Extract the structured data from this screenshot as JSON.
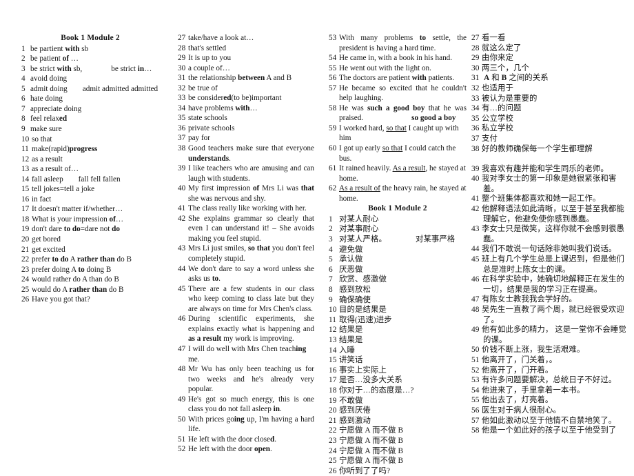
{
  "document": {
    "heading": "Book 1 Module 2",
    "columns": {
      "english_left": {
        "heading": "Book 1 Module 2",
        "items": [
          {
            "n": "1",
            "text": "be partient with sb"
          },
          {
            "n": "2",
            "text": "be patient of …"
          },
          {
            "n": "3",
            "text": "be strict with sb,        be strict in…"
          },
          {
            "n": "4",
            "text": "avoid doing"
          },
          {
            "n": "5",
            "text": "admit doing     admit admitted admitted"
          },
          {
            "n": "6",
            "text": "hate doing"
          },
          {
            "n": "7",
            "text": "appreciate doing"
          },
          {
            "n": "8",
            "text": "feel relaxed"
          },
          {
            "n": "9",
            "text": "make sure"
          },
          {
            "n": "10",
            "text": "so that"
          },
          {
            "n": "11",
            "text": "make(rapid)progress"
          },
          {
            "n": "12",
            "text": "as a result"
          },
          {
            "n": "13",
            "text": "as a result of…"
          },
          {
            "n": "14",
            "text": "fall asleep     fall fell fallen"
          },
          {
            "n": "15",
            "text": "tell jokes=tell a joke"
          },
          {
            "n": "16",
            "text": "in fact"
          },
          {
            "n": "17",
            "text": "It doesn't matter if/whether…"
          },
          {
            "n": "18",
            "text": "What is your impression of…"
          },
          {
            "n": "19",
            "text": "don't dare to do=dare not do"
          },
          {
            "n": "20",
            "text": "get bored"
          },
          {
            "n": "21",
            "text": "get excited"
          },
          {
            "n": "22",
            "text": "prefer to do A rather than do B"
          },
          {
            "n": "23",
            "text": "prefer doing A to doing B"
          },
          {
            "n": "24",
            "text": "would rather do A than do B"
          },
          {
            "n": "25",
            "text": "would do A rather than do B"
          },
          {
            "n": "26",
            "text": "Have you got that?"
          }
        ]
      },
      "english_right": {
        "items": [
          {
            "n": "27",
            "text": "take/have a look at…"
          },
          {
            "n": "28",
            "text": "that's settled"
          },
          {
            "n": "29",
            "text": "It is up to you"
          },
          {
            "n": "30",
            "text": "a couple of…"
          },
          {
            "n": "31",
            "text": "the relationship between A and B"
          },
          {
            "n": "32",
            "text": "be true of"
          },
          {
            "n": "33",
            "text": "be considered(to be)important"
          },
          {
            "n": "34",
            "text": "have problems with…"
          },
          {
            "n": "35",
            "text": "state schools"
          },
          {
            "n": "36",
            "text": "private schools"
          },
          {
            "n": "37",
            "text": "pay for"
          },
          {
            "n": "38",
            "text": "Good teachers make sure that everyone understands."
          },
          {
            "n": "39",
            "text": "I like teachers who are amusing and can laugh with students."
          },
          {
            "n": "40",
            "text": "My first impression of Mrs Li was that she was nervous and shy."
          },
          {
            "n": "41",
            "text": "The class really like working with her."
          },
          {
            "n": "42",
            "text": "She explains grammar so clearly that even I can understand it! – She avoids making you feel stupid."
          },
          {
            "n": "43",
            "text": "Mrs Li just smiles, so that you don't feel completely stupid."
          },
          {
            "n": "44",
            "text": "We don't dare to say a word unless she asks us to."
          },
          {
            "n": "45",
            "text": "There are a few students in our class who keep coming to class late but they are always on time for Mrs Chen's class."
          },
          {
            "n": "46",
            "text": "During scientific experiments, she explains exactly what is happening and as a result my work is improving."
          },
          {
            "n": "47",
            "text": "I will do well with Mrs Chen teaching me."
          },
          {
            "n": "48",
            "text": "Mr Wu has only been teaching us for two weeks and he's already very popular."
          },
          {
            "n": "49",
            "text": "He's got so much energy, this is one class you do not fall asleep in."
          },
          {
            "n": "50",
            "text": "With prices going up, I'm having a hard life."
          },
          {
            "n": "51",
            "text": "He left with the door closed."
          },
          {
            "n": "52",
            "text": "He left with the door open."
          }
        ]
      },
      "english_tail_and_chinese_left": {
        "english_items": [
          {
            "n": "53",
            "text": "With many problems to settle, the president is having a hard time."
          },
          {
            "n": "54",
            "text": "He came in, with a book in his hand."
          },
          {
            "n": "55",
            "text": "He went out with the light on."
          },
          {
            "n": "56",
            "text": "The doctors are patient with patients."
          },
          {
            "n": "57",
            "text": "He became so excited that he couldn't help laughing."
          },
          {
            "n": "58",
            "text": "He was such a good boy that he was praised.              so good a boy"
          },
          {
            "n": "59",
            "text": "I worked hard, so that I caught up with him"
          },
          {
            "n": "60",
            "text": "I got up early so that I could catch the bus."
          },
          {
            "n": "61",
            "text": "It rained heavily. As a result, he stayed at home."
          },
          {
            "n": "62",
            "text": "As a result of the heavy rain, he stayed at home."
          }
        ],
        "heading": "Book 1 Module 2",
        "chinese_items": [
          {
            "n": "1",
            "text": "对某人耐心"
          },
          {
            "n": "2",
            "text": "对某事耐心"
          },
          {
            "n": "3",
            "text": "对某人严格。        对某事严格"
          },
          {
            "n": "4",
            "text": "避免做"
          },
          {
            "n": "5",
            "text": "承认做"
          },
          {
            "n": "6",
            "text": "厌恶做"
          },
          {
            "n": "7",
            "text": "欣赏、感激做"
          },
          {
            "n": "8",
            "text": "感到放松"
          },
          {
            "n": "9",
            "text": "确保确使"
          },
          {
            "n": "10",
            "text": "目的是结果是"
          },
          {
            "n": "11",
            "text": "取得(迅速)进步"
          },
          {
            "n": "12",
            "text": "结果是"
          },
          {
            "n": "13",
            "text": "结果是"
          },
          {
            "n": "14",
            "text": "入睡"
          },
          {
            "n": "15",
            "text": "讲笑话"
          },
          {
            "n": "16",
            "text": "事实上实际上"
          },
          {
            "n": "17",
            "text": "是否…没多大关系"
          },
          {
            "n": "18",
            "text": "你对于…的态度是…?"
          },
          {
            "n": "19",
            "text": "不敢做"
          },
          {
            "n": "20",
            "text": "感到厌倦"
          },
          {
            "n": "21",
            "text": "感到激动"
          },
          {
            "n": "22",
            "text": "宁愿做 A 而不做 B"
          },
          {
            "n": "23",
            "text": "宁愿做 A 而不做 B"
          },
          {
            "n": "24",
            "text": "宁愿做 A 而不做 B"
          },
          {
            "n": "25",
            "text": "宁愿做 A 而不做 B"
          },
          {
            "n": "26",
            "text": "你听到了了吗?"
          }
        ]
      },
      "chinese_right": {
        "items": [
          {
            "n": "27",
            "text": "看一看"
          },
          {
            "n": "28",
            "text": "就这么定了"
          },
          {
            "n": "29",
            "text": "由你来定"
          },
          {
            "n": "30",
            "text": "两三个，几个"
          },
          {
            "n": "31",
            "text": " A 和 B 之间的关系"
          },
          {
            "n": "32",
            "text": "也适用于"
          },
          {
            "n": "33",
            "text": "被认为是重要的"
          },
          {
            "n": "34",
            "text": "有…的问题"
          },
          {
            "n": "35",
            "text": "公立学校"
          },
          {
            "n": "36",
            "text": "私立学校"
          },
          {
            "n": "37",
            "text": "支付"
          },
          {
            "n": "38",
            "text": "好的教师确保每一个学生都理解"
          },
          {
            "n": "39",
            "text": "我喜欢有趣并能和学生同乐的老师。"
          },
          {
            "n": "40",
            "text": "我对李女士的第一印象是她很紧张和害羞。"
          },
          {
            "n": "41",
            "text": "整个班集体都喜欢和她一起工作。"
          },
          {
            "n": "42",
            "text": "他解释语法如此清晰，以至于甚至我都能理解它，他避免使你感到愚蠢。"
          },
          {
            "n": "43",
            "text": "李女士只是微笑，这样你就不会感到很愚蠢。"
          },
          {
            "n": "44",
            "text": "我们不敢说一句话除非她叫我们说话。"
          },
          {
            "n": "45",
            "text": "班上有几个学生总是上课迟到，但是他们总是准时上陈女士的课。"
          },
          {
            "n": "46",
            "text": "在科学实验中，她确切地解释正在发生的一切，结果是我的学习正在提高。"
          },
          {
            "n": "47",
            "text": "有陈女士教我我会学好的。"
          },
          {
            "n": "48",
            "text": "吴先生一直教了两个周，就已经很受欢迎了。"
          },
          {
            "n": "49",
            "text": "他有如此多的精力， 这是一堂你不会睡觉的课。"
          },
          {
            "n": "50",
            "text": "价钱不断上涨，我生活艰难。"
          },
          {
            "n": "51",
            "text": "他离开了，门关着，。"
          },
          {
            "n": "52",
            "text": "他离开了，门开着。"
          },
          {
            "n": "53",
            "text": "有许多问题要解决，总统日子不好过。"
          },
          {
            "n": "54",
            "text": "他进来了，手里拿着一本书。"
          },
          {
            "n": "55",
            "text": "他出去了，灯亮着。"
          },
          {
            "n": "56",
            "text": "医生对于病人很耐心。"
          },
          {
            "n": "57",
            "text": "他如此激动以至于他情不自禁地笑了。"
          },
          {
            "n": "58",
            "text": "他是一个如此好的孩子以至于他受到了"
          }
        ]
      }
    }
  }
}
